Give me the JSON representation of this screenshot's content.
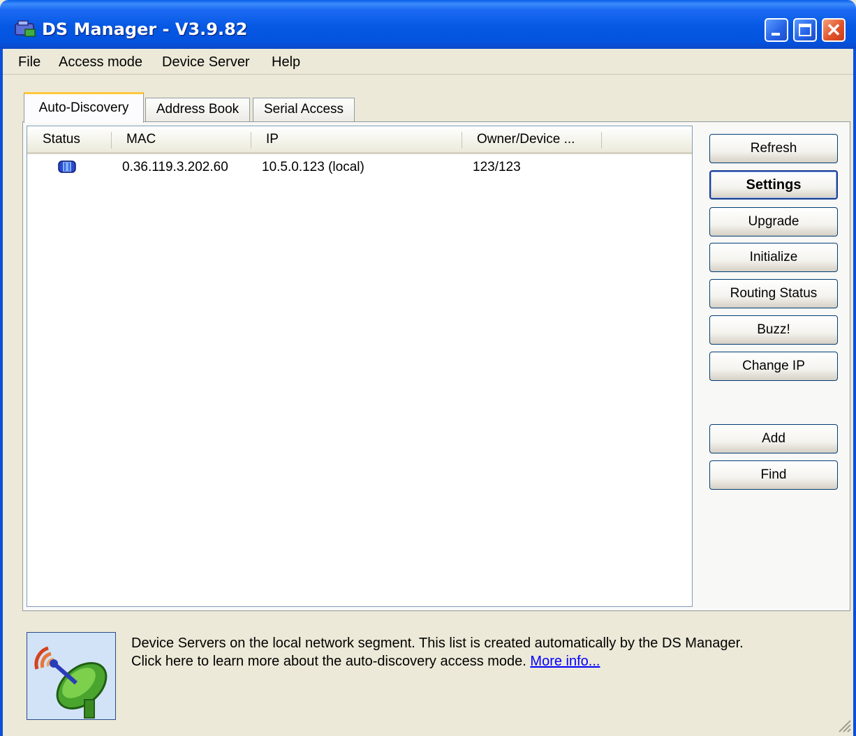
{
  "window": {
    "title": "DS Manager - V3.9.82"
  },
  "menu": [
    "File",
    "Access mode",
    "Device Server",
    "Help"
  ],
  "tabs": [
    {
      "label": "Auto-Discovery",
      "active": true
    },
    {
      "label": "Address Book",
      "active": false
    },
    {
      "label": "Serial Access",
      "active": false
    }
  ],
  "list": {
    "columns": [
      "Status",
      "MAC",
      "IP",
      "Owner/Device ..."
    ],
    "rows": [
      {
        "status_icon": "device-server-icon",
        "mac": "0.36.119.3.202.60",
        "ip": "10.5.0.123 (local)",
        "owner_device": "123/123"
      }
    ]
  },
  "buttons": {
    "refresh": "Refresh",
    "settings": "Settings",
    "upgrade": "Upgrade",
    "initialize": "Initialize",
    "routing_status": "Routing Status",
    "buzz": "Buzz!",
    "change_ip": "Change IP",
    "add": "Add",
    "find": "Find"
  },
  "info": {
    "icon": "satellite-dish-icon",
    "line1": "Device Servers on the local network segment. This list is created automatically by the DS Manager.",
    "line2_prefix": "Click here to learn more about the auto-discovery access mode.",
    "link_text": "More info..."
  },
  "colors": {
    "titlebar": "#0558e3",
    "link": "#0000ff",
    "default_button_border": "#1a3d8f"
  }
}
